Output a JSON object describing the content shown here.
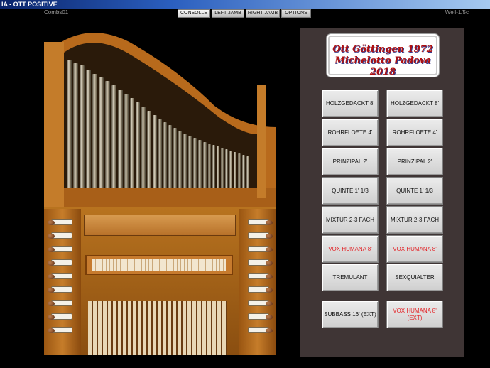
{
  "window": {
    "title": "IA - OTT POSITIVE"
  },
  "toolbar": {
    "combination": "Combs01",
    "temperament": "Well-1/5c",
    "tabs": [
      {
        "label": "CONSOLLE",
        "active": true
      },
      {
        "label": "LEFT JAMB",
        "active": false
      },
      {
        "label": "RIGHT JAMB",
        "active": false
      },
      {
        "label": "OPTIONS",
        "active": false
      }
    ]
  },
  "nameplate": {
    "line1": "Ott Göttingen 1972",
    "line2": "Michelotto Padova 2018"
  },
  "stops_left": [
    {
      "label": "HOLZGEDACKT 8'",
      "color": "#111111"
    },
    {
      "label": "ROHRFLOETE 4'",
      "color": "#111111"
    },
    {
      "label": "PRINZIPAL 2'",
      "color": "#111111"
    },
    {
      "label": "QUINTE 1' 1/3",
      "color": "#111111"
    },
    {
      "label": "MIXTUR 2-3 FACH",
      "color": "#111111"
    },
    {
      "label": "VOX HUMANA 8'",
      "color": "#e3262a"
    },
    {
      "label": "TREMULANT",
      "color": "#111111"
    },
    {
      "label": "SUBBASS 16' (EXT)",
      "color": "#111111"
    }
  ],
  "stops_right": [
    {
      "label": "HOLZGEDACKT 8'",
      "color": "#111111"
    },
    {
      "label": "ROHRFLOETE 4'",
      "color": "#111111"
    },
    {
      "label": "PRINZIPAL 2'",
      "color": "#111111"
    },
    {
      "label": "QUINTE 1' 1/3",
      "color": "#111111"
    },
    {
      "label": "MIXTUR 2-3 FACH",
      "color": "#111111"
    },
    {
      "label": "VOX HUMANA 8'",
      "color": "#e3262a"
    },
    {
      "label": "SEXQUIALTER",
      "color": "#111111"
    },
    {
      "label": "VOX HUMANA 8' (EXT)",
      "color": "#e3262a"
    }
  ],
  "colors": {
    "panel": "#3f3535",
    "background": "#000000",
    "accent_red": "#e3262a"
  }
}
